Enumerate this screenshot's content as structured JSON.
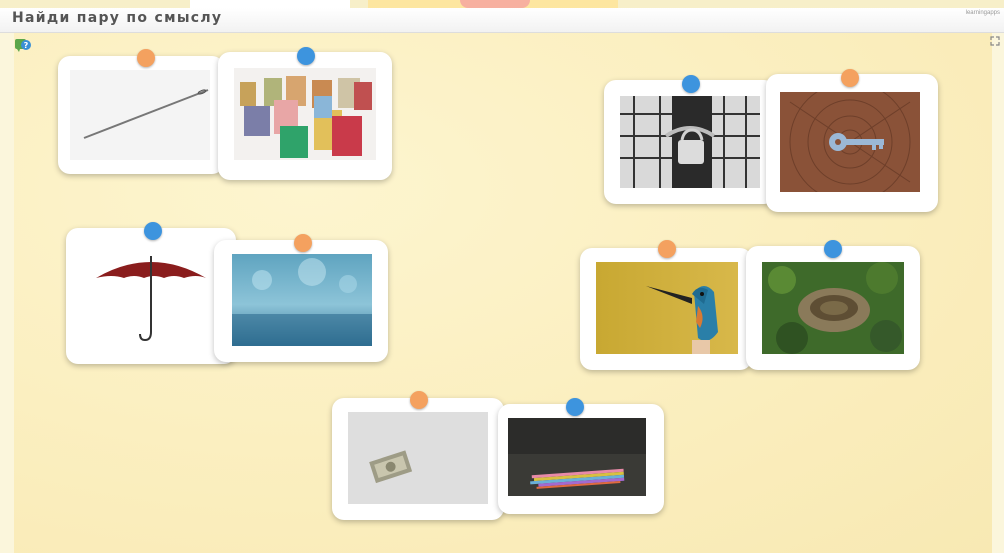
{
  "app": {
    "title": "Найди пару по смыслу",
    "corner_link": "learningapps"
  },
  "colors": {
    "pin_orange": "#f4a15f",
    "pin_blue": "#3d94de",
    "board_bg": "#fbefc0"
  },
  "icons": {
    "help": "help-icon",
    "fullscreen": "fullscreen-icon"
  },
  "cards": [
    {
      "name": "card-needle",
      "depicts": "needle",
      "pin": "orange"
    },
    {
      "name": "card-thread-spools",
      "depicts": "thread spools",
      "pin": "blue"
    },
    {
      "name": "card-padlock",
      "depicts": "padlock on gate",
      "pin": "blue"
    },
    {
      "name": "card-key",
      "depicts": "key on wood",
      "pin": "orange"
    },
    {
      "name": "card-umbrella",
      "depicts": "umbrella",
      "pin": "blue"
    },
    {
      "name": "card-rain",
      "depicts": "rain",
      "pin": "orange"
    },
    {
      "name": "card-bird",
      "depicts": "kingfisher",
      "pin": "orange"
    },
    {
      "name": "card-nest",
      "depicts": "nest",
      "pin": "blue"
    },
    {
      "name": "card-money",
      "depicts": "money",
      "pin": "orange"
    },
    {
      "name": "card-pencils",
      "depicts": "pencils",
      "pin": "blue"
    }
  ]
}
